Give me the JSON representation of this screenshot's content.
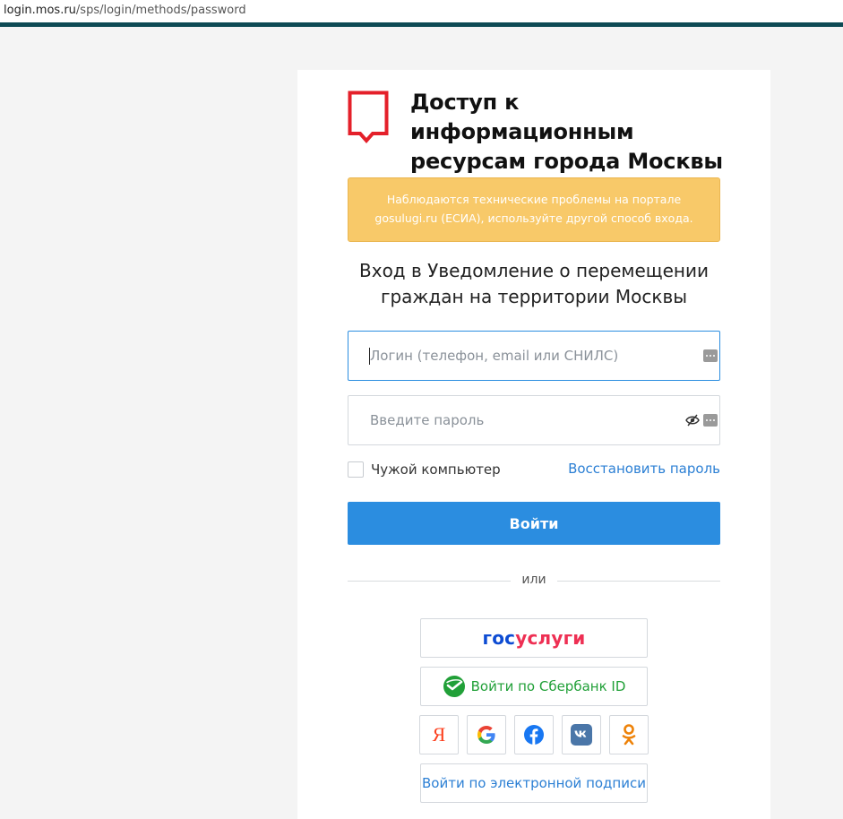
{
  "browser": {
    "url_domain": "login.mos.ru",
    "url_path": "/sps/login/methods/password"
  },
  "brand": {
    "title_line1": "Доступ к информационным",
    "title_line2": "ресурсам города Москвы",
    "logo_icon": "mos-ru-logo",
    "logo_color": "#e4202a"
  },
  "alert": {
    "line1": "Наблюдаются технические проблемы на портале",
    "line2": "gosulugi.ru (ЕСИА), используйте другой способ входа.",
    "color": "#f8c969"
  },
  "service": {
    "line1": "Вход в Уведомление о перемещении",
    "line2": "граждан на территории Москвы"
  },
  "form": {
    "login_placeholder": "Логин (телефон, email или СНИЛС)",
    "login_value": "",
    "password_placeholder": "Введите пароль",
    "password_value": "",
    "checkbox_label": "Чужой компьютер",
    "restore_link": "Восстановить пароль",
    "submit_label": "Войти",
    "accent": "#2b8de0"
  },
  "divider_text": "или",
  "alt_logins": {
    "gosuslugi_part1": "гос",
    "gosuslugi_part2": "услуги",
    "sber_label": "Войти по Сбербанк ID",
    "esign_label": "Войти по электронной подписи",
    "social": [
      "yandex",
      "google",
      "facebook",
      "vk",
      "odnoklassniki"
    ],
    "yandex_glyph": "Я"
  }
}
